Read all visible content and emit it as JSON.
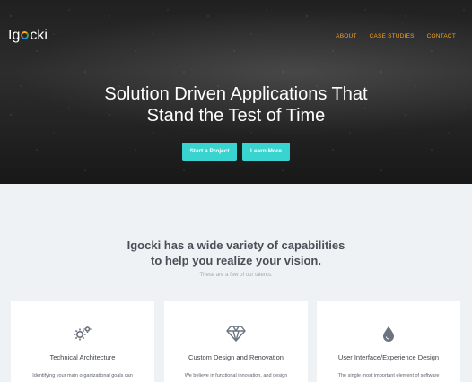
{
  "brand": {
    "name_prefix": "Ig",
    "name_suffix": "cki"
  },
  "nav": {
    "items": [
      "ABOUT",
      "CASE STUDIES",
      "CONTACT"
    ]
  },
  "hero": {
    "headline_line1": "Solution Driven Applications That",
    "headline_line2": "Stand the Test of Time",
    "start_button": "Start a Project",
    "learn_button": "Learn More"
  },
  "capabilities": {
    "title_line1": "Igocki has a wide variety of capabilities",
    "title_line2": "to help you realize your vision.",
    "subtitle": "These are a few of our talents.",
    "cards": [
      {
        "icon": "gears-icon",
        "title": "Technical Architecture",
        "desc": "Identifying your main organizational goals can"
      },
      {
        "icon": "diamond-icon",
        "title": "Custom Design and Renovation",
        "desc": "We believe in functional innovation, and design"
      },
      {
        "icon": "drop-icon",
        "title": "User Interface/Experience Design",
        "desc": "The single most important element of software"
      }
    ]
  },
  "colors": {
    "accent": "#39d4cf",
    "nav": "#f0a12a",
    "icon": "#6c7480"
  }
}
